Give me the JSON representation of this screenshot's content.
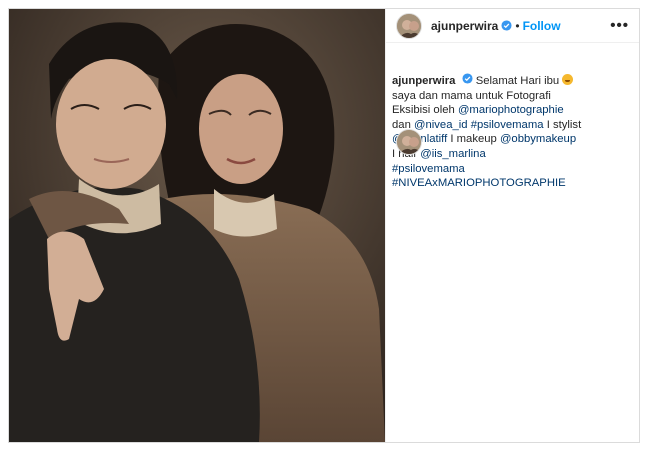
{
  "post": {
    "username": "ajunperwira",
    "separator": "•",
    "follow_label": "Follow",
    "more_label": "•••",
    "caption": {
      "line1_text": "Selamat Hari ibu",
      "line2": "saya dan mama untuk Fotografi",
      "line3_text": "Eksibisi oleh",
      "mention_mario": "@mariophotographie",
      "line4_prefix": "dan",
      "mention_nivea": "@nivea_id",
      "hashtag_psilovemama": "#psilovemama",
      "line4_suffix": "I stylist",
      "mention_iwan": "@iwanlatiff",
      "line5_mid": "I makeup",
      "mention_obby": "@obbymakeup",
      "line6_prefix": "I hair",
      "mention_iis": "@iis_marlina",
      "hashtag_2": "#psilovemama",
      "hashtag_3": "#NIVEAxMARIOPHOTOGRAPHIE"
    },
    "accent_color": "#0095f6",
    "link_color": "#00376b"
  }
}
